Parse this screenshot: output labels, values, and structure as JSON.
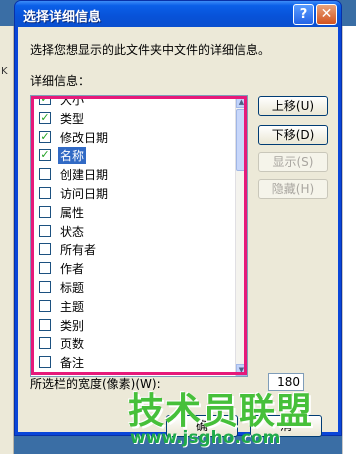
{
  "window": {
    "title": "选择详细信息",
    "help_glyph": "?",
    "close_glyph": "✕"
  },
  "background": {
    "left_fragment": "K"
  },
  "dialog": {
    "description": "选择您想显示的此文件夹中文件的详细信息。",
    "details_label": "详细信息：",
    "items": [
      {
        "label": "大小",
        "checked": true,
        "selected": false
      },
      {
        "label": "类型",
        "checked": true,
        "selected": false
      },
      {
        "label": "修改日期",
        "checked": true,
        "selected": false
      },
      {
        "label": "名称",
        "checked": true,
        "selected": true
      },
      {
        "label": "创建日期",
        "checked": false,
        "selected": false
      },
      {
        "label": "访问日期",
        "checked": false,
        "selected": false
      },
      {
        "label": "属性",
        "checked": false,
        "selected": false
      },
      {
        "label": "状态",
        "checked": false,
        "selected": false
      },
      {
        "label": "所有者",
        "checked": false,
        "selected": false
      },
      {
        "label": "作者",
        "checked": false,
        "selected": false
      },
      {
        "label": "标题",
        "checked": false,
        "selected": false
      },
      {
        "label": "主题",
        "checked": false,
        "selected": false
      },
      {
        "label": "类别",
        "checked": false,
        "selected": false
      },
      {
        "label": "页数",
        "checked": false,
        "selected": false
      },
      {
        "label": "备注",
        "checked": false,
        "selected": false
      }
    ],
    "buttons": {
      "move_up": "上移(U)",
      "move_down": "下移(D)",
      "show": "显示(S)",
      "hide": "隐藏(H)"
    },
    "width_label": "所选栏的宽度(像素)(W):",
    "width_value": "180",
    "ok_fragment": "确",
    "cancel_fragment": "消"
  },
  "watermark": {
    "text": "技术员联盟",
    "url": "www.jsgho.com"
  },
  "colors": {
    "highlight": "#e6197a",
    "title_bar": "#0a5fe8",
    "selection": "#316ac5"
  }
}
